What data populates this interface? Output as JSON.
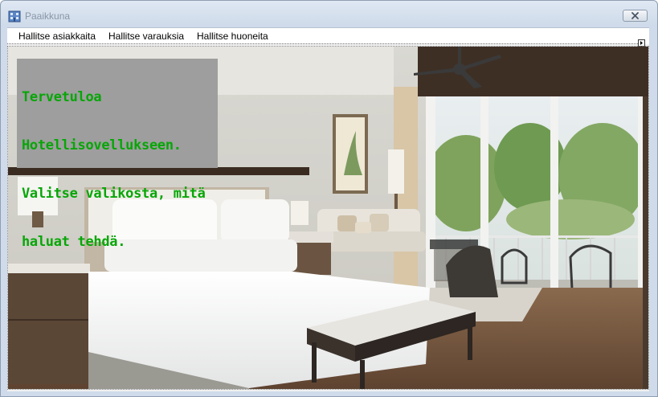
{
  "window": {
    "title": "Paaikkuna",
    "icons": {
      "app": "building-icon",
      "close": "close-icon"
    }
  },
  "menu": {
    "items": [
      {
        "label": "Hallitse asiakkaita"
      },
      {
        "label": "Hallitse varauksia"
      },
      {
        "label": "Hallitse huoneita"
      }
    ]
  },
  "welcome": {
    "line1": "Tervetuloa",
    "line2": "Hotellisovellukseen.",
    "line3": "Valitse valikosta, mitä",
    "line4": "haluat tehdä."
  },
  "colors": {
    "welcome_text": "#07a607",
    "welcome_panel": "#9e9e9e"
  }
}
